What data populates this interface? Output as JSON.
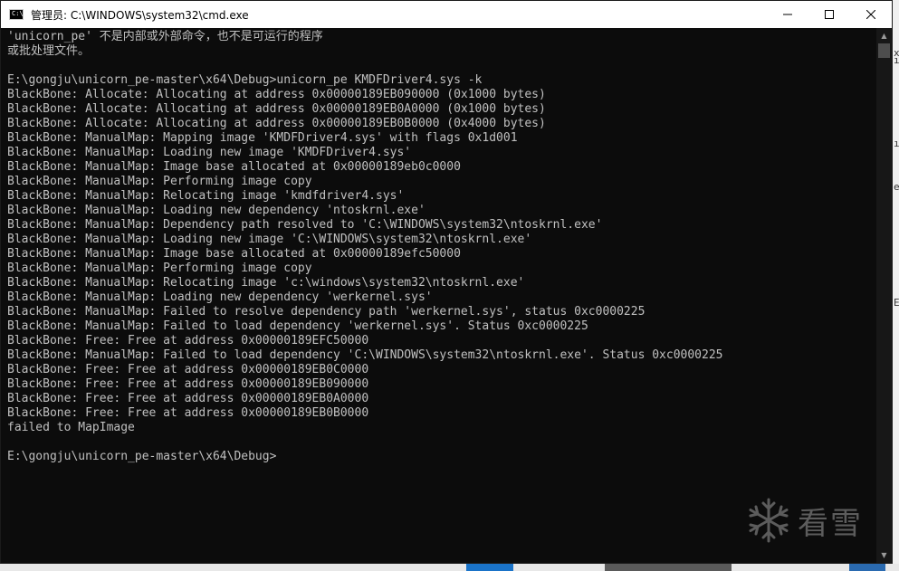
{
  "window": {
    "title": "管理员: C:\\WINDOWS\\system32\\cmd.exe",
    "icon_text": "C:\\",
    "icons": {
      "app": "cmd-icon",
      "minimize": "minimize-icon",
      "maximize": "maximize-icon",
      "close": "close-icon"
    }
  },
  "console": {
    "lines": [
      "'unicorn_pe' 不是内部或外部命令，也不是可运行的程序",
      "或批处理文件。",
      "",
      "E:\\gongju\\unicorn_pe-master\\x64\\Debug>unicorn_pe KMDFDriver4.sys -k",
      "BlackBone: Allocate: Allocating at address 0x00000189EB090000 (0x1000 bytes)",
      "BlackBone: Allocate: Allocating at address 0x00000189EB0A0000 (0x1000 bytes)",
      "BlackBone: Allocate: Allocating at address 0x00000189EB0B0000 (0x4000 bytes)",
      "BlackBone: ManualMap: Mapping image 'KMDFDriver4.sys' with flags 0x1d001",
      "BlackBone: ManualMap: Loading new image 'KMDFDriver4.sys'",
      "BlackBone: ManualMap: Image base allocated at 0x00000189eb0c0000",
      "BlackBone: ManualMap: Performing image copy",
      "BlackBone: ManualMap: Relocating image 'kmdfdriver4.sys'",
      "BlackBone: ManualMap: Loading new dependency 'ntoskrnl.exe'",
      "BlackBone: ManualMap: Dependency path resolved to 'C:\\WINDOWS\\system32\\ntoskrnl.exe'",
      "BlackBone: ManualMap: Loading new image 'C:\\WINDOWS\\system32\\ntoskrnl.exe'",
      "BlackBone: ManualMap: Image base allocated at 0x00000189efc50000",
      "BlackBone: ManualMap: Performing image copy",
      "BlackBone: ManualMap: Relocating image 'c:\\windows\\system32\\ntoskrnl.exe'",
      "BlackBone: ManualMap: Loading new dependency 'werkernel.sys'",
      "BlackBone: ManualMap: Failed to resolve dependency path 'werkernel.sys', status 0xc0000225",
      "BlackBone: ManualMap: Failed to load dependency 'werkernel.sys'. Status 0xc0000225",
      "BlackBone: Free: Free at address 0x00000189EFC50000",
      "BlackBone: ManualMap: Failed to load dependency 'C:\\WINDOWS\\system32\\ntoskrnl.exe'. Status 0xc0000225",
      "BlackBone: Free: Free at address 0x00000189EB0C0000",
      "BlackBone: Free: Free at address 0x00000189EB090000",
      "BlackBone: Free: Free at address 0x00000189EB0A0000",
      "BlackBone: Free: Free at address 0x00000189EB0B0000",
      "failed to MapImage",
      "",
      "E:\\gongju\\unicorn_pe-master\\x64\\Debug>"
    ]
  },
  "watermark": {
    "text": "看雪",
    "icon": "snowflake-icon"
  },
  "side_fragments": [
    "x",
    "ıl",
    "ıs",
    "e",
    "Ei"
  ],
  "colors": {
    "console_bg": "#0c0c0c",
    "console_fg": "#c0c0c0",
    "titlebar_bg": "#ffffff"
  }
}
